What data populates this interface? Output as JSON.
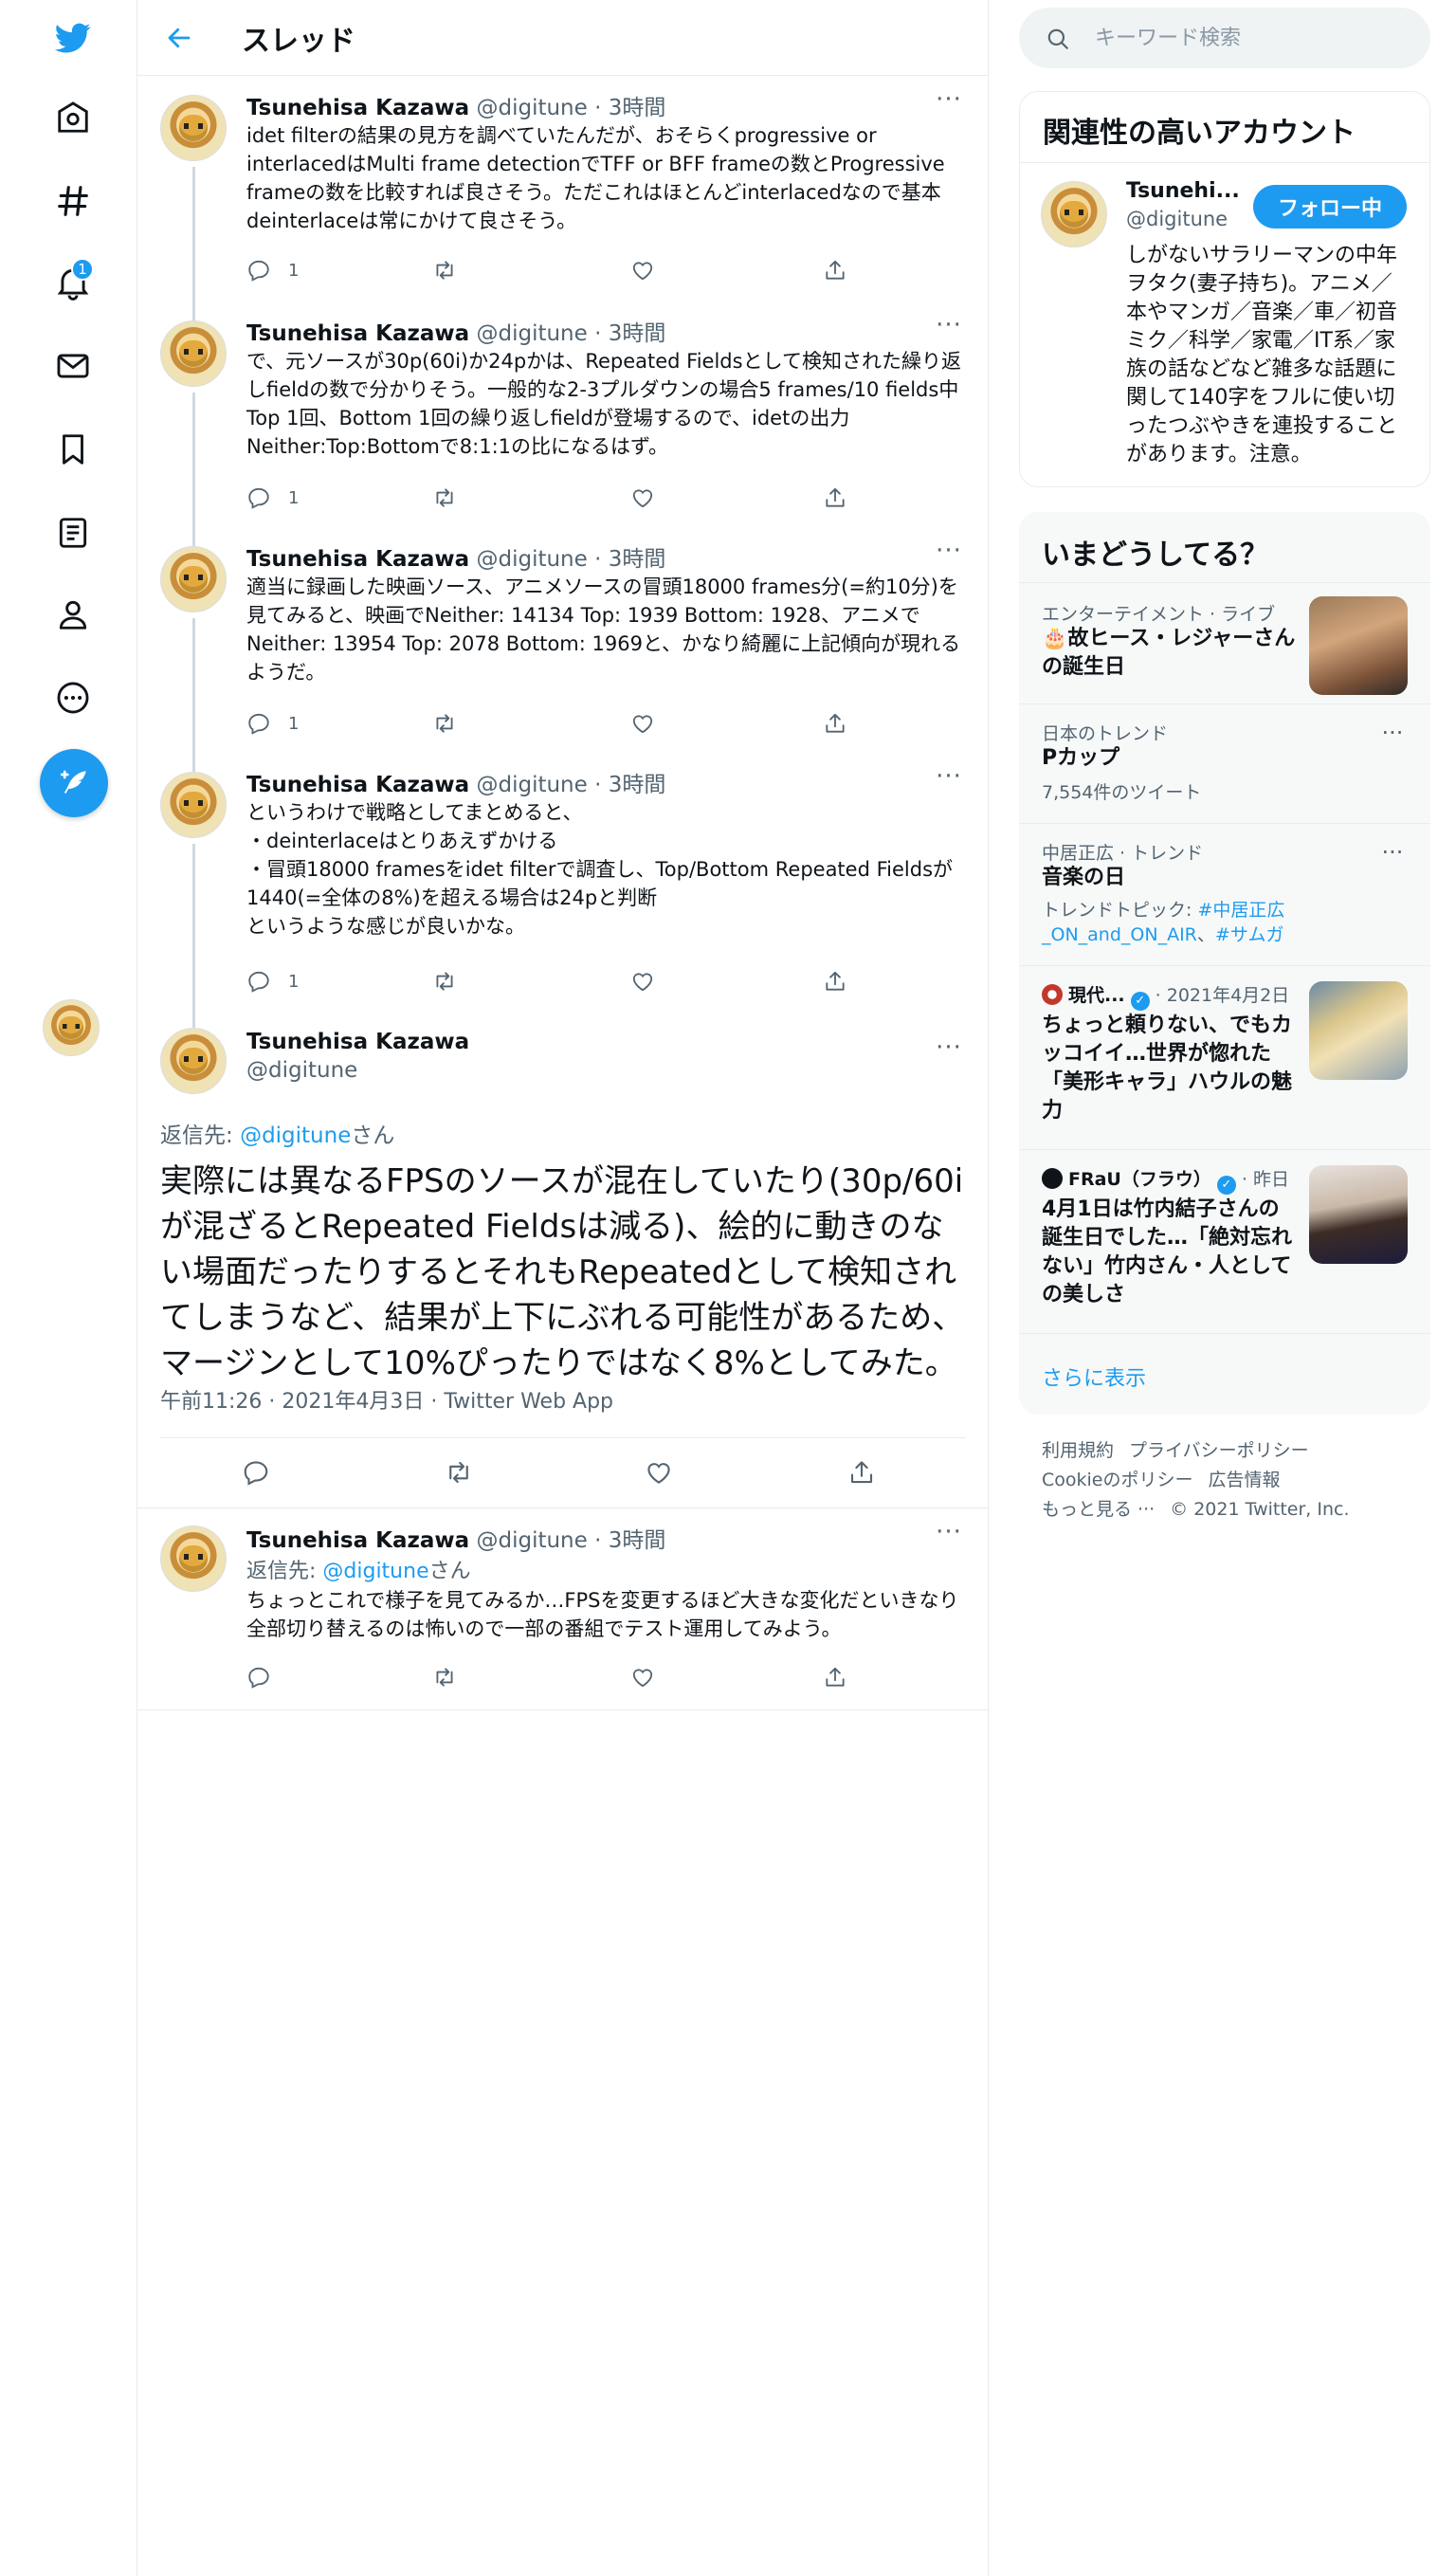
{
  "nav": {
    "notification_count": "1"
  },
  "header": {
    "title": "スレッド"
  },
  "tweets": [
    {
      "name": "Tsunehisa Kazawa",
      "handle": "@digitune",
      "time": "· 3時間",
      "text": "idet filterの結果の見方を調べていたんだが、おそらくprogressive or interlacedはMulti frame detectionでTFF or BFF frameの数とProgressive frameの数を比較すれば良さそう。ただこれはほとんどinterlacedなので基本deinterlaceは常にかけて良さそう。",
      "replies": "1"
    },
    {
      "name": "Tsunehisa Kazawa",
      "handle": "@digitune",
      "time": "· 3時間",
      "text": "で、元ソースが30p(60i)か24pかは、Repeated Fieldsとして検知された繰り返しfieldの数で分かりそう。一般的な2-3プルダウンの場合5 frames/10 fields中Top 1回、Bottom 1回の繰り返しfieldが登場するので、idetの出力Neither:Top:Bottomで8:1:1の比になるはず。",
      "replies": "1"
    },
    {
      "name": "Tsunehisa Kazawa",
      "handle": "@digitune",
      "time": "· 3時間",
      "text": "適当に録画した映画ソース、アニメソースの冒頭18000 frames分(=約10分)を見てみると、映画でNeither: 14134 Top:  1939 Bottom:  1928、アニメでNeither: 13954 Top:  2078 Bottom:  1969と、かなり綺麗に上記傾向が現れるようだ。",
      "replies": "1"
    },
    {
      "name": "Tsunehisa Kazawa",
      "handle": "@digitune",
      "time": "· 3時間",
      "text": "というわけで戦略としてまとめると、\n・deinterlaceはとりあえずかける\n・冒頭18000 framesをidet filterで調査し、Top/Bottom Repeated Fieldsが1440(=全体の8%)を超える場合は24pと判断\nというような感じが良いかな。",
      "replies": "1"
    }
  ],
  "focus_tweet": {
    "name": "Tsunehisa Kazawa",
    "handle": "@digitune",
    "reply_prefix": "返信先: ",
    "reply_to": "@digitune",
    "reply_suffix": "さん",
    "text": "実際には異なるFPSのソースが混在していたり(30p/60iが混ざるとRepeated Fieldsは減る)、絵的に動きのない場面だったりするとそれもRepeatedとして検知されてしまうなど、結果が上下にぶれる可能性があるため、マージンとして10%ぴったりではなく8%としてみた。",
    "timestamp": "午前11:26 · 2021年4月3日 · Twitter Web App"
  },
  "reply_tweet": {
    "name": "Tsunehisa Kazawa",
    "handle": "@digitune",
    "time": "· 3時間",
    "reply_prefix": "返信先: ",
    "reply_to": "@digitune",
    "reply_suffix": "さん",
    "text": "ちょっとこれで様子を見てみるか…FPSを変更するほど大きな変化だといきなり全部切り替えるのは怖いので一部の番組でテスト運用してみよう。"
  },
  "search": {
    "placeholder": "キーワード検索"
  },
  "related": {
    "title": "関連性の高いアカウント",
    "name": "Tsunehi...",
    "handle": "@digitune",
    "follow_label": "フォロー中",
    "bio": "しがないサラリーマンの中年ヲタク(妻子持ち)。アニメ／本やマンガ／音楽／車／初音ミク／科学／家電／IT系／家族の話などなど雑多な話題に関して140字をフルに使い切ったつぶやきを連投することがあります。注意。"
  },
  "trends": {
    "title": "いまどうしてる？",
    "items": [
      {
        "category": "エンターテイメント · ライブ",
        "title": "🎂故ヒース・レジャーさんの誕生日"
      },
      {
        "category": "日本のトレンド",
        "title": "Pカップ",
        "sub": "7,554件のツイート"
      },
      {
        "category": "中居正広 · トレンド",
        "title": "音楽の日",
        "sub_prefix": "トレンドトピック: ",
        "sub_link1": "#中居正広_ON_and_ON_AIR",
        "sub_sep": "、",
        "sub_link2": "#サムガ"
      },
      {
        "source": "現代...",
        "time": "· 2021年4月2日",
        "title": "ちょっと頼りない、でもカッコイイ…世界が惚れた「美形キャラ」ハウルの魅力"
      },
      {
        "source": "FRaU（フラウ）",
        "time": "· 昨日",
        "title": "4月1日は竹内結子さんの誕生日でした…「絶対忘れない」竹内さん・人としての美しさ"
      }
    ],
    "show_more": "さらに表示"
  },
  "footer": {
    "terms": "利用規約",
    "privacy": "プライバシーポリシー",
    "cookie": "Cookieのポリシー",
    "ads": "広告情報",
    "more": "もっと見る ···",
    "copyright": "© 2021 Twitter, Inc."
  },
  "colors": {
    "accent": "#1d9bf0",
    "text": "#0f1419",
    "secondary": "#536471",
    "border": "#e6ecf0"
  }
}
